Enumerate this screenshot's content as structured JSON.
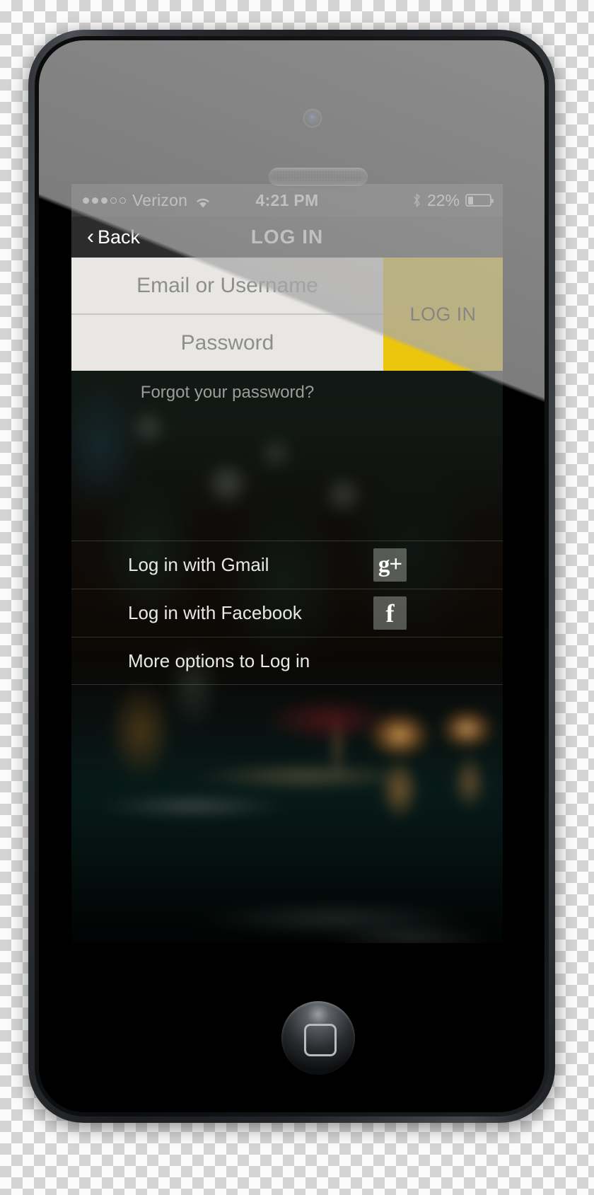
{
  "device": {
    "name": "iPhone 5",
    "camera": "front-camera",
    "speaker": "earpiece-speaker",
    "home_button": "home-button"
  },
  "statusbar": {
    "signal_dots_filled": 3,
    "signal_dots_total": 5,
    "carrier": "Verizon",
    "wifi_icon": "wifi-icon",
    "time": "4:21 PM",
    "bluetooth_icon": "bluetooth-icon",
    "battery_percent": "22%",
    "battery_level": 22,
    "colors": {
      "bar_bg": "#39393a",
      "text": "#ffffff"
    }
  },
  "navbar": {
    "back_label": "Back",
    "back_chevron": "chevron-left-icon",
    "title": "LOG IN",
    "bg": "#2c2c2d"
  },
  "form": {
    "email_placeholder": "Email or Username",
    "email_value": "",
    "password_placeholder": "Password",
    "password_value": "",
    "login_button_label": "LOG IN",
    "login_button_color": "#ebc60d",
    "field_bg": "#e9e7e4",
    "forgot_label": "Forgot your password?"
  },
  "social": {
    "rows": [
      {
        "label": "Log in with Gmail",
        "icon": "google-plus-icon",
        "glyph": "g+"
      },
      {
        "label": "Log in with Facebook",
        "icon": "facebook-icon",
        "glyph": "f"
      },
      {
        "label": "More options to Log in",
        "icon": "",
        "glyph": ""
      }
    ]
  },
  "wallpaper": {
    "description": "blurred night city street with warm lights"
  }
}
